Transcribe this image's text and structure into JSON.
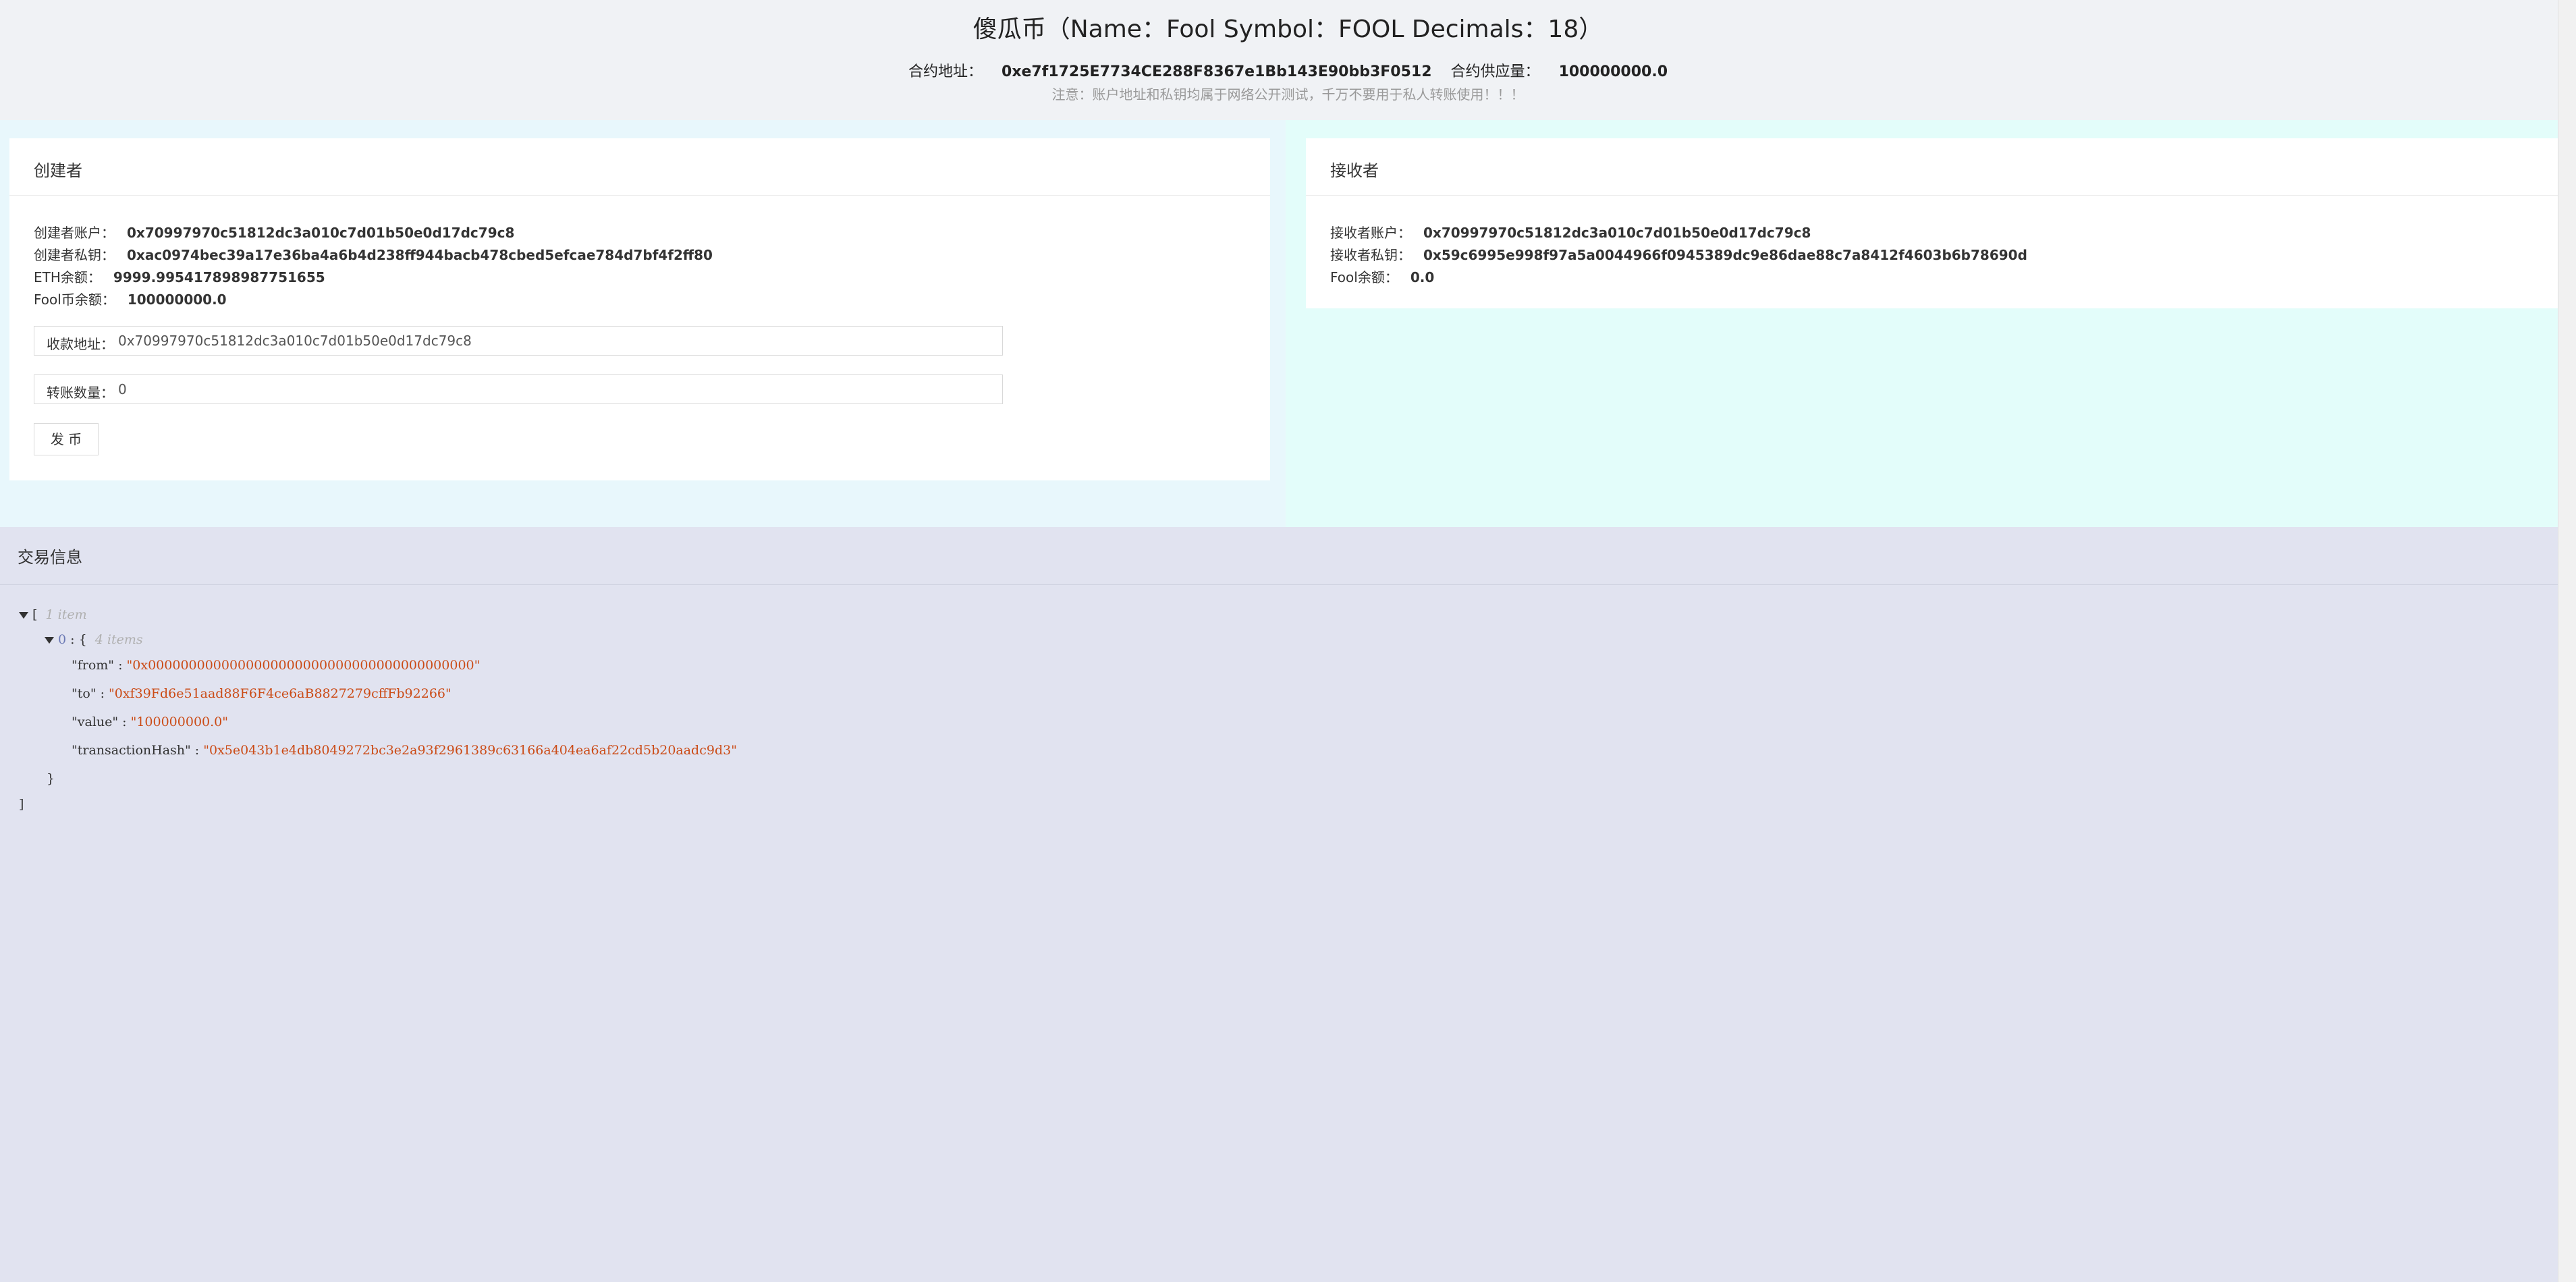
{
  "header": {
    "title": "傻瓜币（Name：Fool Symbol：FOOL Decimals：18）",
    "contract_address_label": "合约地址：",
    "contract_address": "0xe7f1725E7734CE288F8367e1Bb143E90bb3F0512",
    "supply_label": "合约供应量：",
    "supply": "100000000.0",
    "notice": "注意：账户地址和私钥均属于网络公开测试，千万不要用于私人转账使用！！！"
  },
  "creator": {
    "title": "创建者",
    "account_label": "创建者账户：",
    "account": "0x70997970c51812dc3a010c7d01b50e0d17dc79c8",
    "private_key_label": "创建者私钥：",
    "private_key": "0xac0974bec39a17e36ba4a6b4d238ff944bacb478cbed5efcae784d7bf4f2ff80",
    "eth_label": "ETH余额：",
    "eth_balance": "9999.995417898987751655",
    "fool_label": "Fool币余额：",
    "fool_balance": "100000000.0",
    "receive_label": "收款地址：",
    "receive_value": "0x70997970c51812dc3a010c7d01b50e0d17dc79c8",
    "amount_label": "转账数量：",
    "amount_value": "0",
    "issue_button": "发 币"
  },
  "receiver": {
    "title": "接收者",
    "account_label": "接收者账户：",
    "account": "0x70997970c51812dc3a010c7d01b50e0d17dc79c8",
    "private_key_label": "接收者私钥：",
    "private_key": "0x59c6995e998f97a5a0044966f0945389dc9e86dae88c7a8412f4603b6b78690d",
    "fool_label": "Fool余额：",
    "fool_balance": "0.0"
  },
  "transactions": {
    "title": "交易信息",
    "open_bracket": "[",
    "array_meta": "1 item",
    "item_index": "0",
    "item_colon": " : ",
    "item_open": "{",
    "item_meta": "4 items",
    "from_key": "\"from\"",
    "from_value": "\"0x0000000000000000000000000000000000000000\"",
    "to_key": "\"to\"",
    "to_value": "\"0xf39Fd6e51aad88F6F4ce6aB8827279cffFb92266\"",
    "value_key": "\"value\"",
    "value_value": "\"100000000.0\"",
    "hash_key": "\"transactionHash\"",
    "hash_value": "\"0x5e043b1e4db8049272bc3e2a93f2961389c63166a404ea6af22cd5b20aadc9d3\"",
    "kv_sep": " : ",
    "close_brace": "}",
    "close_bracket": "]"
  }
}
